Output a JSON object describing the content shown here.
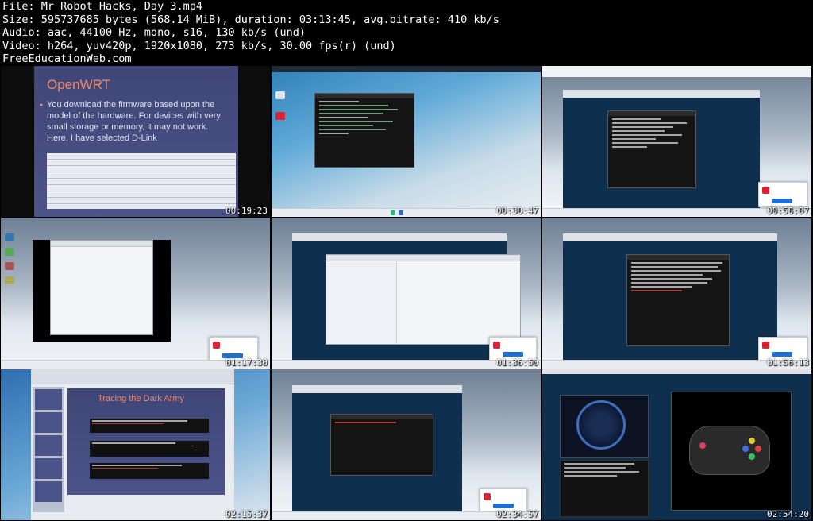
{
  "header": {
    "file": "File: Mr Robot Hacks, Day 3.mp4",
    "size": "Size: 595737685 bytes (568.14 MiB), duration: 03:13:45, avg.bitrate: 410 kb/s",
    "audio": "Audio: aac, 44100 Hz, mono, s16, 130 kb/s (und)",
    "video": "Video: h264, yuv420p, 1920x1080, 273 kb/s, 30.00 fps(r) (und)",
    "site": "FreeEducationWeb.com"
  },
  "thumbnails": [
    {
      "timestamp": "00:19:23",
      "kind": "slide",
      "slide_title": "OpenWRT",
      "slide_text": "You download the firmware based upon the model of the hardware. For devices with very small storage or memory, it may not work. Here, I have selected D-Link"
    },
    {
      "timestamp": "00:38:47",
      "kind": "terminal-desktop"
    },
    {
      "timestamp": "00:58:07",
      "kind": "vm-terminal"
    },
    {
      "timestamp": "01:17:30",
      "kind": "dialog-desktop"
    },
    {
      "timestamp": "01:36:50",
      "kind": "file-explorer"
    },
    {
      "timestamp": "01:56:13",
      "kind": "vm-terminal"
    },
    {
      "timestamp": "02:15:37",
      "kind": "powerpoint",
      "slide_title": "Tracing the Dark Army"
    },
    {
      "timestamp": "02:34:57",
      "kind": "vm-terminal"
    },
    {
      "timestamp": "02:54:20",
      "kind": "controller"
    }
  ],
  "colors": {
    "accent_slide": "#f08a6b",
    "slide_bg": "#4c5389",
    "kali_blue": "#2f7fb7"
  }
}
